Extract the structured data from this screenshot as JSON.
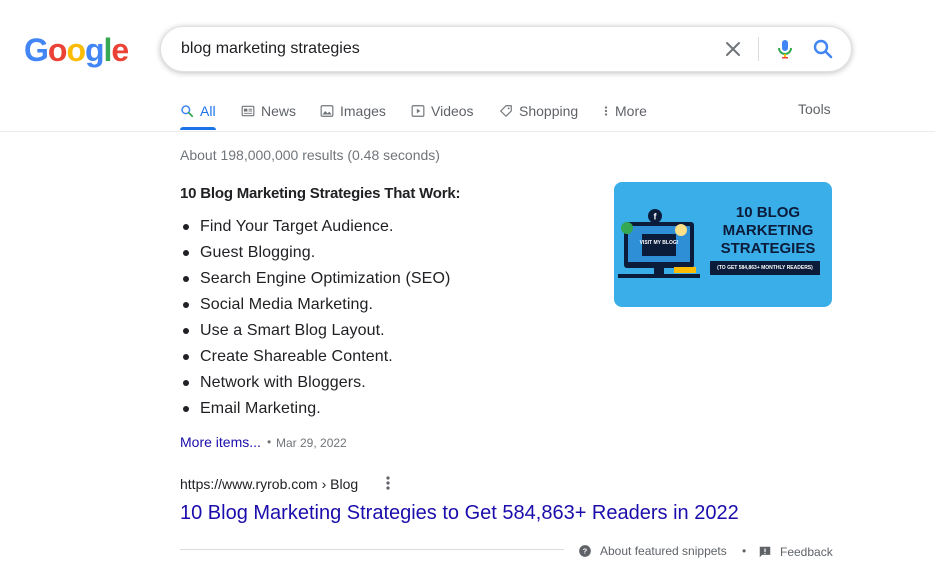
{
  "logo": {
    "letters": [
      "G",
      "o",
      "o",
      "g",
      "l",
      "e"
    ],
    "colors": [
      "#4285f4",
      "#ea4335",
      "#fbbc05",
      "#4285f4",
      "#34a853",
      "#ea4335"
    ]
  },
  "search": {
    "query": "blog marketing strategies"
  },
  "tabs": [
    {
      "label": "All",
      "icon": "search-icon",
      "active": true
    },
    {
      "label": "News",
      "icon": "news-icon"
    },
    {
      "label": "Images",
      "icon": "image-icon"
    },
    {
      "label": "Videos",
      "icon": "video-icon"
    },
    {
      "label": "Shopping",
      "icon": "tag-icon"
    },
    {
      "label": "More",
      "icon": "more-vert-icon"
    }
  ],
  "tools_label": "Tools",
  "result_stats": "About 198,000,000 results (0.48 seconds)",
  "snippet": {
    "heading": "10 Blog Marketing Strategies That Work:",
    "items": [
      "Find Your Target Audience.",
      "Guest Blogging.",
      "Search Engine Optimization (SEO)",
      "Social Media Marketing.",
      "Use a Smart Blog Layout.",
      "Create Shareable Content.",
      "Network with Bloggers.",
      "Email Marketing."
    ],
    "more_items": "More items...",
    "separator": "•",
    "date": "Mar 29, 2022",
    "thumbnail": {
      "title": "10 BLOG MARKETING STRATEGIES",
      "subtitle": "(TO GET 584,863+ MONTHLY READERS)",
      "screen_text": "VISIT MY BLOG!",
      "background": "#3aaee8"
    }
  },
  "result": {
    "url": "https://www.ryrob.com › Blog",
    "title": "10 Blog Marketing Strategies to Get 584,863+ Readers in 2022"
  },
  "footer": {
    "about_snippets": "About featured snippets",
    "separator": "•",
    "feedback": "Feedback"
  },
  "colors": {
    "link": "#1a0dab",
    "accent": "#1a73e8",
    "muted": "#70757a"
  }
}
